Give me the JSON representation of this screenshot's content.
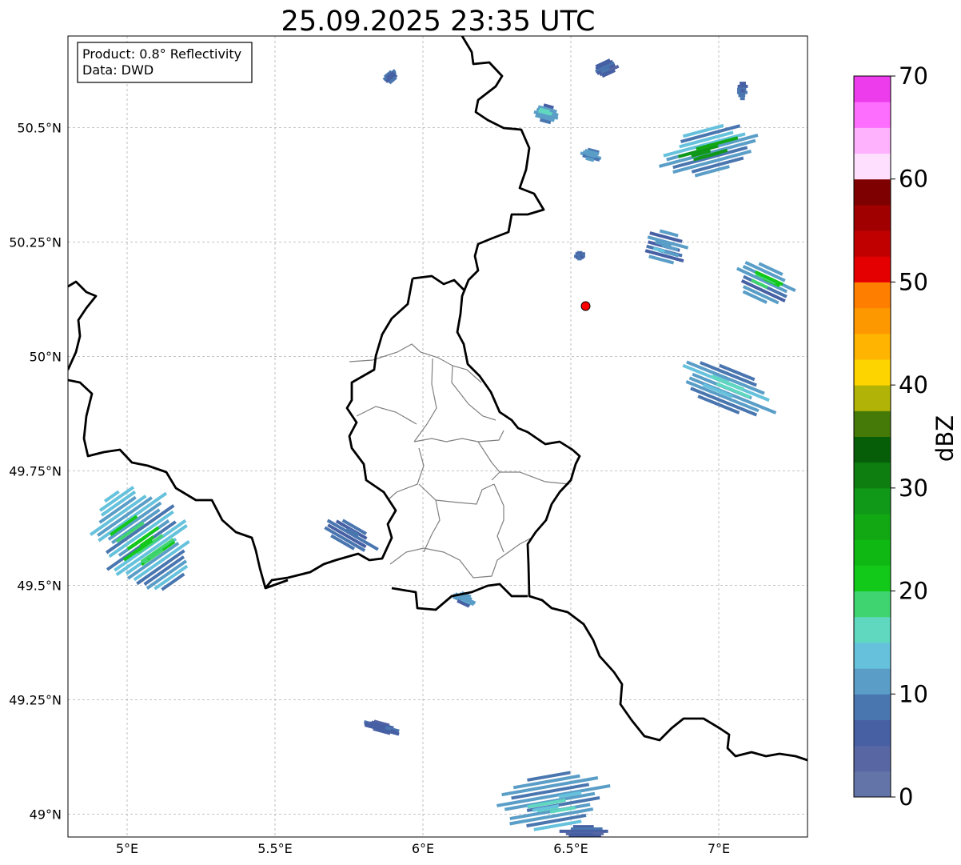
{
  "title": "25.09.2025 23:35 UTC",
  "info": {
    "product": "Product: 0.8° Reflectivity",
    "data": "Data: DWD"
  },
  "map_extent": {
    "lon": [
      4.8,
      7.3
    ],
    "lat": [
      48.95,
      50.7
    ]
  },
  "x_ticks": [
    {
      "value": 5.0,
      "label": "5°E"
    },
    {
      "value": 5.5,
      "label": "5.5°E"
    },
    {
      "value": 6.0,
      "label": "6°E"
    },
    {
      "value": 6.5,
      "label": "6.5°E"
    },
    {
      "value": 7.0,
      "label": "7°E"
    }
  ],
  "y_ticks": [
    {
      "value": 50.5,
      "label": "50.5°N"
    },
    {
      "value": 50.25,
      "label": "50.25°N"
    },
    {
      "value": 50.0,
      "label": "50°N"
    },
    {
      "value": 49.75,
      "label": "49.75°N"
    },
    {
      "value": 49.5,
      "label": "49.5°N"
    },
    {
      "value": 49.25,
      "label": "49.25°N"
    },
    {
      "value": 49.0,
      "label": "49°N"
    }
  ],
  "radar_site": {
    "lon": 6.55,
    "lat": 50.11,
    "color": "#ff0000"
  },
  "colorbar": {
    "label": "dBZ",
    "range": [
      0,
      70
    ],
    "ticks": [
      {
        "value": 0,
        "label": "0"
      },
      {
        "value": 10,
        "label": "10"
      },
      {
        "value": 20,
        "label": "20"
      },
      {
        "value": 30,
        "label": "30"
      },
      {
        "value": 40,
        "label": "40"
      },
      {
        "value": 50,
        "label": "50"
      },
      {
        "value": 60,
        "label": "60"
      },
      {
        "value": 70,
        "label": "70"
      }
    ],
    "colors": [
      "#6374a8",
      "#5866a4",
      "#4760a4",
      "#4a76b0",
      "#5a9ec8",
      "#66c2dc",
      "#60d8c0",
      "#40d470",
      "#12c818",
      "#10b814",
      "#12a814",
      "#109818",
      "#0e7e10",
      "#065f08",
      "#457a08",
      "#b1b406",
      "#fed400",
      "#feb400",
      "#fe9800",
      "#fe7e00",
      "#e40000",
      "#c00000",
      "#a00000",
      "#7e0000",
      "#fee0fe",
      "#feb2fe",
      "#fe6efe",
      "#ec3cec"
    ]
  },
  "colors": {
    "border": "#000000",
    "admin": "#808080",
    "grid": "#b0b0b0"
  },
  "echoes": [
    {
      "lon": 5.05,
      "lat": 49.6,
      "rx": 0.16,
      "ry": 0.12,
      "rot": -35,
      "level": 12,
      "core": 22
    },
    {
      "lon": 6.97,
      "lat": 50.45,
      "rx": 0.17,
      "ry": 0.05,
      "rot": -15,
      "level": 12,
      "core": 30
    },
    {
      "lon": 6.45,
      "lat": 49.03,
      "rx": 0.2,
      "ry": 0.06,
      "rot": -10,
      "level": 10,
      "core": 17
    },
    {
      "lon": 7.03,
      "lat": 49.93,
      "rx": 0.17,
      "ry": 0.045,
      "rot": 22,
      "level": 10,
      "core": 18
    },
    {
      "lon": 7.15,
      "lat": 50.16,
      "rx": 0.12,
      "ry": 0.04,
      "rot": 25,
      "level": 10,
      "core": 22
    },
    {
      "lon": 6.82,
      "lat": 50.24,
      "rx": 0.09,
      "ry": 0.035,
      "rot": 15,
      "level": 8,
      "core": 14
    },
    {
      "lon": 6.42,
      "lat": 50.53,
      "rx": 0.05,
      "ry": 0.02,
      "rot": 15,
      "level": 9,
      "core": 18
    },
    {
      "lon": 6.62,
      "lat": 50.63,
      "rx": 0.05,
      "ry": 0.015,
      "rot": -25,
      "level": 7,
      "core": 10
    },
    {
      "lon": 6.57,
      "lat": 50.44,
      "rx": 0.04,
      "ry": 0.012,
      "rot": 15,
      "level": 9,
      "core": 14
    },
    {
      "lon": 5.75,
      "lat": 49.61,
      "rx": 0.1,
      "ry": 0.025,
      "rot": 30,
      "level": 7,
      "core": 10
    },
    {
      "lon": 6.14,
      "lat": 49.47,
      "rx": 0.04,
      "ry": 0.012,
      "rot": 25,
      "level": 9,
      "core": 14
    },
    {
      "lon": 5.86,
      "lat": 49.19,
      "rx": 0.07,
      "ry": 0.01,
      "rot": 15,
      "level": 7,
      "core": 9
    },
    {
      "lon": 6.55,
      "lat": 48.96,
      "rx": 0.1,
      "ry": 0.015,
      "rot": 0,
      "level": 6,
      "core": 9
    },
    {
      "lon": 7.08,
      "lat": 50.58,
      "rx": 0.02,
      "ry": 0.02,
      "rot": 0,
      "level": 7,
      "core": 9
    },
    {
      "lon": 5.89,
      "lat": 50.61,
      "rx": 0.03,
      "ry": 0.01,
      "rot": -40,
      "level": 7,
      "core": 9
    },
    {
      "lon": 6.53,
      "lat": 50.22,
      "rx": 0.02,
      "ry": 0.008,
      "rot": 0,
      "level": 7,
      "core": 9
    }
  ]
}
